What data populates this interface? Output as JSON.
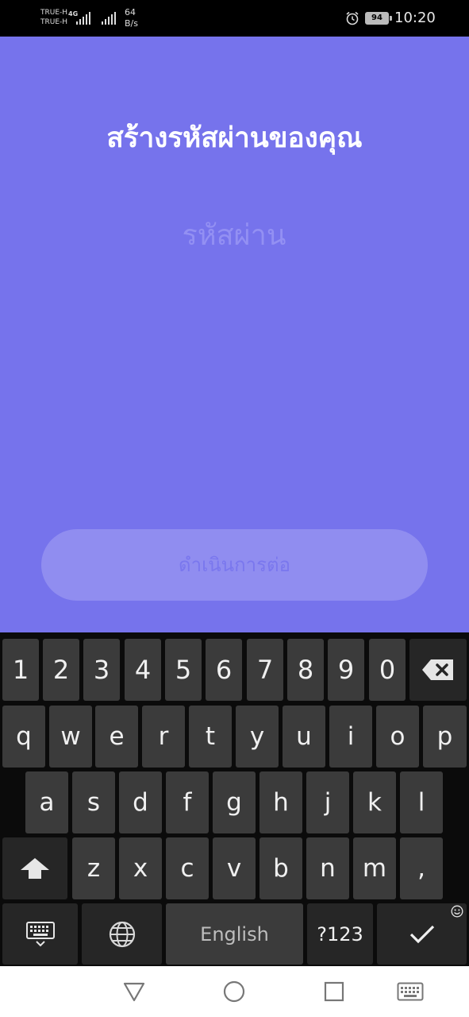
{
  "status_bar": {
    "carrier_top": "TRUE-H",
    "carrier_bottom": "TRUE-H",
    "network_type": "4G",
    "data_speed_value": "64",
    "data_speed_unit": "B/s",
    "battery_level": "94",
    "time": "10:20",
    "icons": [
      "signal-icon",
      "signal-icon",
      "alarm-icon",
      "battery-icon"
    ]
  },
  "main": {
    "title": "สร้างรหัสผ่านของคุณ",
    "password_placeholder": "รหัสผ่าน",
    "password_value": "",
    "continue_label": "ดำเนินการต่อ",
    "colors": {
      "background": "#7673ec",
      "button": "#908df0",
      "button_text": "#7a77ee",
      "placeholder": "#9390f3"
    }
  },
  "keyboard": {
    "number_row": [
      "1",
      "2",
      "3",
      "4",
      "5",
      "6",
      "7",
      "8",
      "9",
      "0"
    ],
    "row1": [
      "q",
      "w",
      "e",
      "r",
      "t",
      "y",
      "u",
      "i",
      "o",
      "p"
    ],
    "row2": [
      "a",
      "s",
      "d",
      "f",
      "g",
      "h",
      "j",
      "k",
      "l"
    ],
    "row3": [
      "z",
      "x",
      "c",
      "v",
      "b",
      "n",
      "m",
      ","
    ],
    "space_label": "English",
    "symbols_label": "?123",
    "icons": [
      "backspace-icon",
      "shift-icon",
      "keyboard-settings-icon",
      "globe-icon",
      "checkmark-icon",
      "emoji-icon"
    ]
  },
  "nav_bar": {
    "icons": [
      "back-icon",
      "home-icon",
      "recents-icon",
      "keyboard-toggle-icon"
    ]
  }
}
